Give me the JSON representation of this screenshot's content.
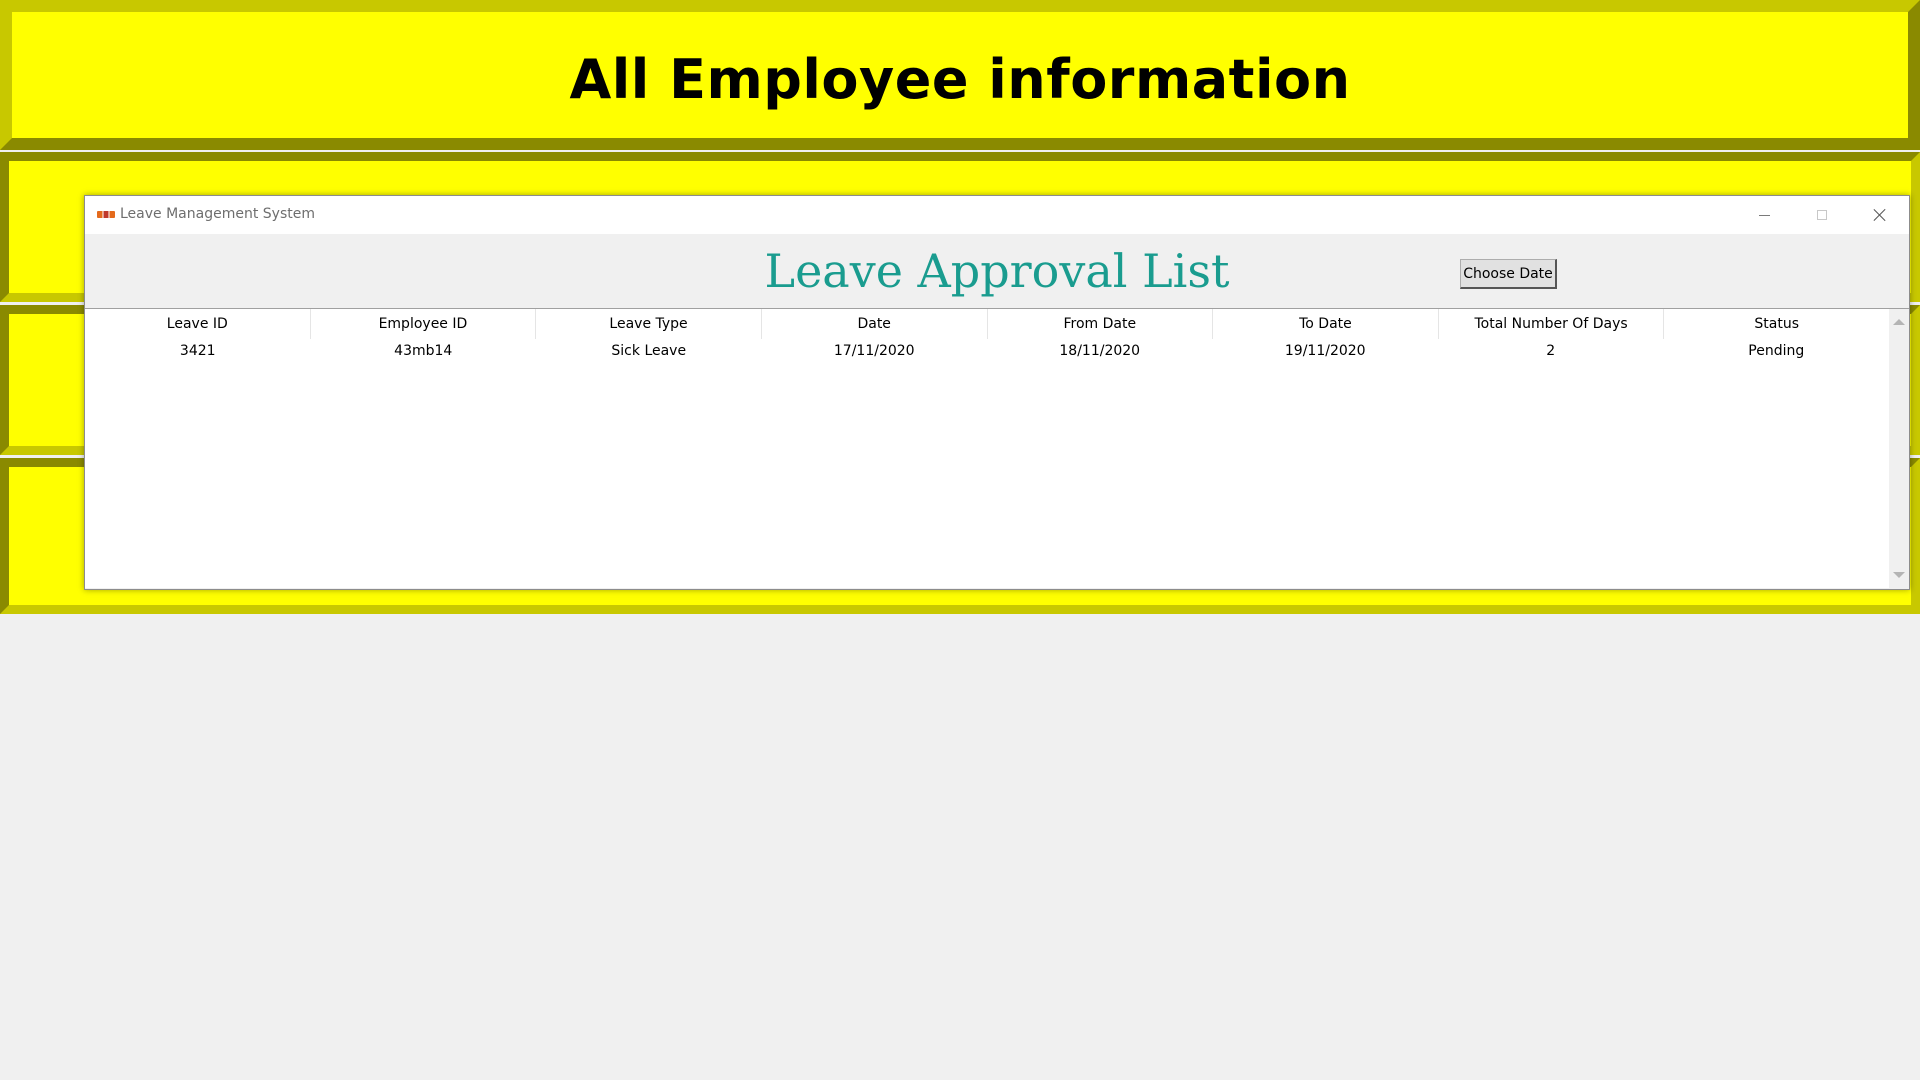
{
  "header": {
    "title": "All Employee information"
  },
  "window": {
    "title": "Leave Management System",
    "icon": "app-logo-icon",
    "controls": {
      "minimize": "minimize-icon",
      "maximize": "maximize-icon",
      "close": "close-icon"
    }
  },
  "page": {
    "title": "Leave Approval List",
    "choose_date_label": "Choose Date"
  },
  "table": {
    "columns": [
      "Leave ID",
      "Employee ID",
      "Leave Type",
      "Date",
      "From Date",
      "To Date",
      "Total Number Of Days",
      "Status"
    ],
    "rows": [
      [
        "3421",
        "43mb14",
        "Sick Leave",
        "17/11/2020",
        "18/11/2020",
        "19/11/2020",
        "2",
        "Pending"
      ]
    ]
  },
  "colors": {
    "panel_yellow": "#ffff00",
    "panel_border": "#8a8a00",
    "title_teal": "#1a9c8f"
  }
}
